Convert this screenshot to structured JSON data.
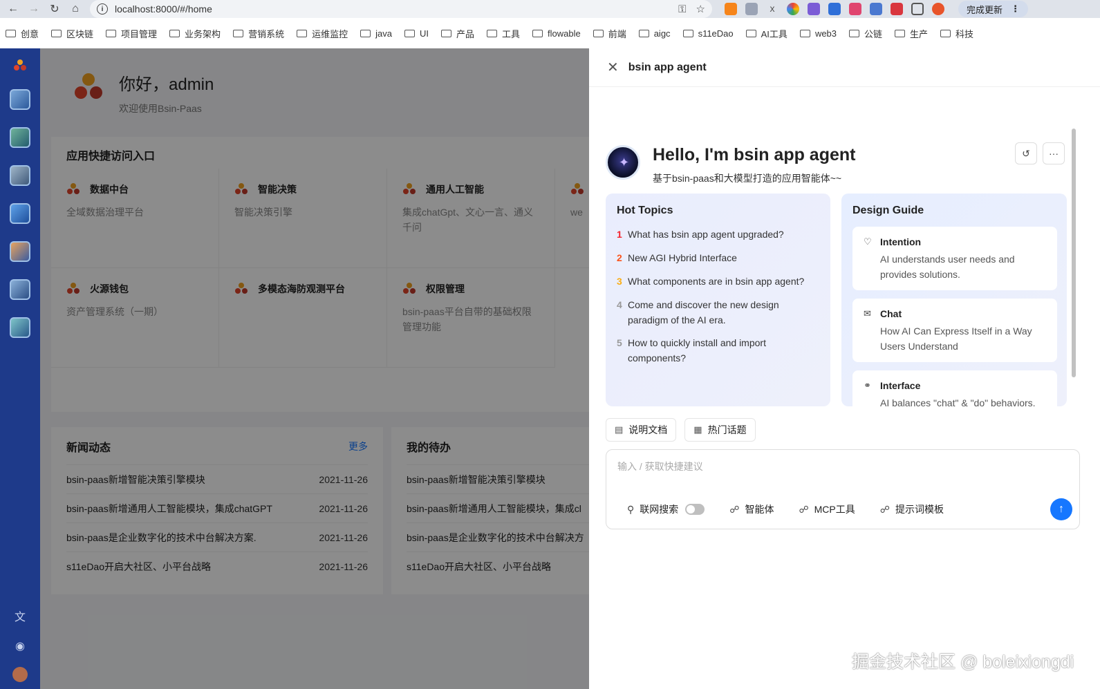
{
  "browser": {
    "url": "localhost:8000/#/home",
    "update_button": "完成更新",
    "bookmarks": [
      "创意",
      "区块链",
      "项目管理",
      "业务架构",
      "营销系统",
      "运维监控",
      "java",
      "UI",
      "产品",
      "工具",
      "flowable",
      "前端",
      "aigc",
      "s11eDao",
      "AI工具",
      "web3",
      "公链",
      "生产",
      "科技"
    ]
  },
  "home": {
    "greeting": "你好，admin",
    "welcome": "欢迎使用Bsin-Paas",
    "quick_title": "应用快捷访问入口",
    "quick_cards": [
      {
        "title": "数据中台",
        "desc": "全域数据治理平台"
      },
      {
        "title": "智能决策",
        "desc": "智能决策引擎"
      },
      {
        "title": "通用人工智能",
        "desc": "集成chatGpt、文心一言、通义千问"
      },
      {
        "title": "",
        "desc": "we"
      },
      {
        "title": "火源钱包",
        "desc": "资产管理系统（一期）"
      },
      {
        "title": "多模态海防观测平台",
        "desc": ""
      },
      {
        "title": "权限管理",
        "desc": "bsin-paas平台自带的基础权限管理功能"
      }
    ],
    "news": {
      "title": "新闻动态",
      "more": "更多",
      "rows": [
        {
          "text": "bsin-paas新增智能决策引擎模块",
          "date": "2021-11-26"
        },
        {
          "text": "bsin-paas新增通用人工智能模块，集成chatGPT",
          "date": "2021-11-26"
        },
        {
          "text": "bsin-paas是企业数字化的技术中台解决方案.",
          "date": "2021-11-26"
        },
        {
          "text": "s11eDao开启大社区、小平台战略",
          "date": "2021-11-26"
        }
      ]
    },
    "todo": {
      "title": "我的待办",
      "rows": [
        {
          "text": "bsin-paas新增智能决策引擎模块"
        },
        {
          "text": "bsin-paas新增通用人工智能模块，集成cl"
        },
        {
          "text": "bsin-paas是企业数字化的技术中台解决方"
        },
        {
          "text": "s11eDao开启大社区、小平台战略"
        }
      ]
    }
  },
  "drawer": {
    "title": "bsin app agent",
    "hello_title": "Hello, I'm bsin app agent",
    "hello_sub": "基于bsin-paas和大模型打造的应用智能体~~",
    "hot_topics": {
      "title": "Hot Topics",
      "items": [
        {
          "n": "1",
          "text": "What has bsin app agent upgraded?",
          "color": "#f5222d"
        },
        {
          "n": "2",
          "text": "New AGI Hybrid Interface",
          "color": "#fa541c"
        },
        {
          "n": "3",
          "text": "What components are in bsin app agent?",
          "color": "#faad14"
        },
        {
          "n": "4",
          "text": "Come and discover the new design paradigm of the AI era.",
          "color": "#999999"
        },
        {
          "n": "5",
          "text": "How to quickly install and import components?",
          "color": "#999999"
        }
      ]
    },
    "design_guide": {
      "title": "Design Guide",
      "items": [
        {
          "title": "Intention",
          "desc": "AI understands user needs and provides solutions.",
          "icon": "heart-icon"
        },
        {
          "title": "Chat",
          "desc": "How AI Can Express Itself in a Way Users Understand",
          "icon": "chat-icon"
        },
        {
          "title": "Interface",
          "desc": "AI balances \"chat\" & \"do\" behaviors.",
          "icon": "paperclip-icon"
        }
      ]
    },
    "chips": [
      "说明文档",
      "热门话题"
    ],
    "input_placeholder": "输入 / 获取快捷建议",
    "tools": {
      "web_search": "联网搜索",
      "agent": "智能体",
      "mcp": "MCP工具",
      "prompt": "提示词模板"
    }
  },
  "watermark": "掘金技术社区 @ boleixiongdi"
}
